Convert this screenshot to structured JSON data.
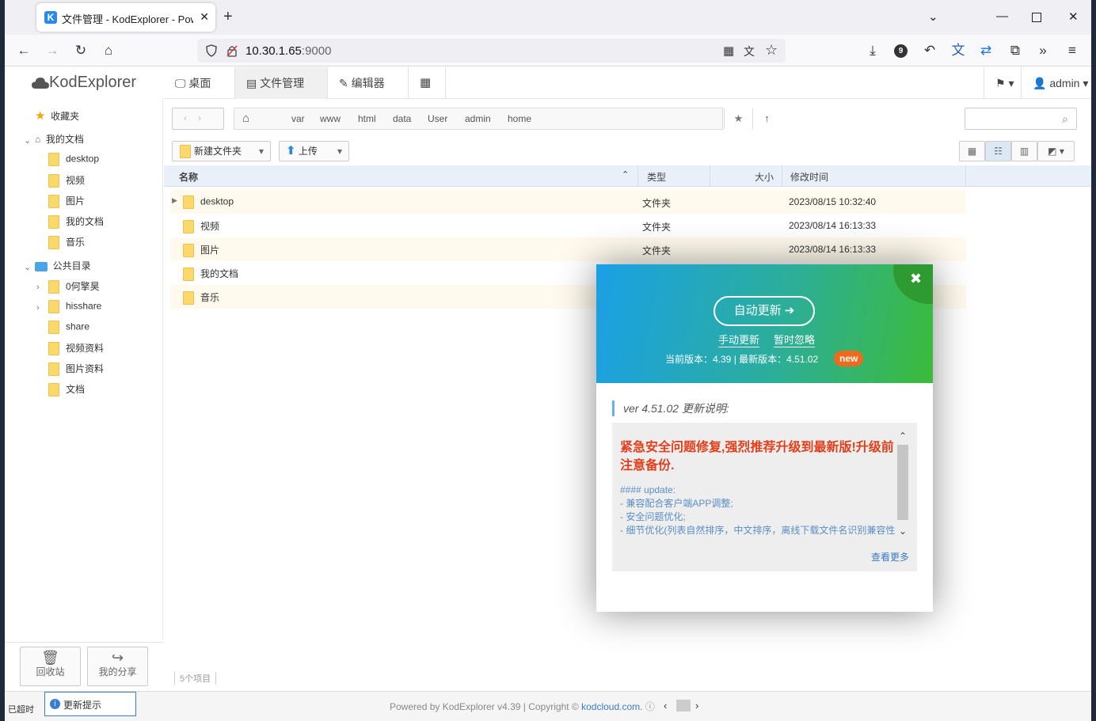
{
  "browser": {
    "tab_title": "文件管理 - KodExplorer - Pow",
    "favicon_letter": "K",
    "url_host": "10.30.1.65",
    "url_port": ":9000",
    "badge_count": "9"
  },
  "app": {
    "logo_text": "KodExplorer",
    "topnav": [
      "桌面",
      "文件管理",
      "编辑器"
    ],
    "user": "admin"
  },
  "sidebar": {
    "favorites": "收藏夹",
    "my_docs": "我的文档",
    "my_docs_children": [
      "desktop",
      "视频",
      "图片",
      "我的文档",
      "音乐"
    ],
    "public": "公共目录",
    "public_children": [
      "0何擎昊",
      "hisshare",
      "share",
      "视频资料",
      "图片资料",
      "文档"
    ],
    "recycle": "回收站",
    "my_share": "我的分享"
  },
  "breadcrumb": [
    "var",
    "www",
    "html",
    "data",
    "User",
    "admin",
    "home"
  ],
  "toolbar": {
    "new_folder": "新建文件夹",
    "upload": "上传"
  },
  "table": {
    "headers": {
      "name": "名称",
      "type": "类型",
      "size": "大小",
      "modified": "修改时间"
    },
    "rows": [
      {
        "name": "desktop",
        "type": "文件夹",
        "modified": "2023/08/15 10:32:40"
      },
      {
        "name": "视频",
        "type": "文件夹",
        "modified": "2023/08/14 16:13:33"
      },
      {
        "name": "图片",
        "type": "文件夹",
        "modified": "2023/08/14 16:13:33"
      },
      {
        "name": "我的文档",
        "type": "",
        "modified": ""
      },
      {
        "name": "音乐",
        "type": "",
        "modified": ""
      }
    ]
  },
  "status": {
    "item_count": "5个项目",
    "timeout": "已超时",
    "update_tip": "更新提示",
    "footer_prefix": "Powered by KodExplorer v4.39 | Copyright © ",
    "footer_link": "kodcloud.com."
  },
  "dialog": {
    "auto_update": "自动更新",
    "manual_update": "手动更新",
    "ignore": "暂时忽略",
    "version_line": "当前版本：4.39 | 最新版本：4.51.02",
    "new_badge": "new",
    "notes_title": "ver 4.51.02 更新说明:",
    "headline": "紧急安全问题修复,强烈推荐升级到最新版!升级前注意备份.",
    "notes": [
      "#### update:",
      "- 兼容配合客户端APP调整;",
      "- 安全问题优化;",
      "- 细节优化(列表自然排序，中文排序，离线下载文件名识别兼容性"
    ],
    "more": "查看更多"
  },
  "colors": {
    "header_gradient_start": "#1aa0e6",
    "header_gradient_end": "#3cbb3a",
    "headline_red": "#e2401c",
    "badge_orange": "#f06a1d",
    "link_blue": "#3a7bc8"
  }
}
